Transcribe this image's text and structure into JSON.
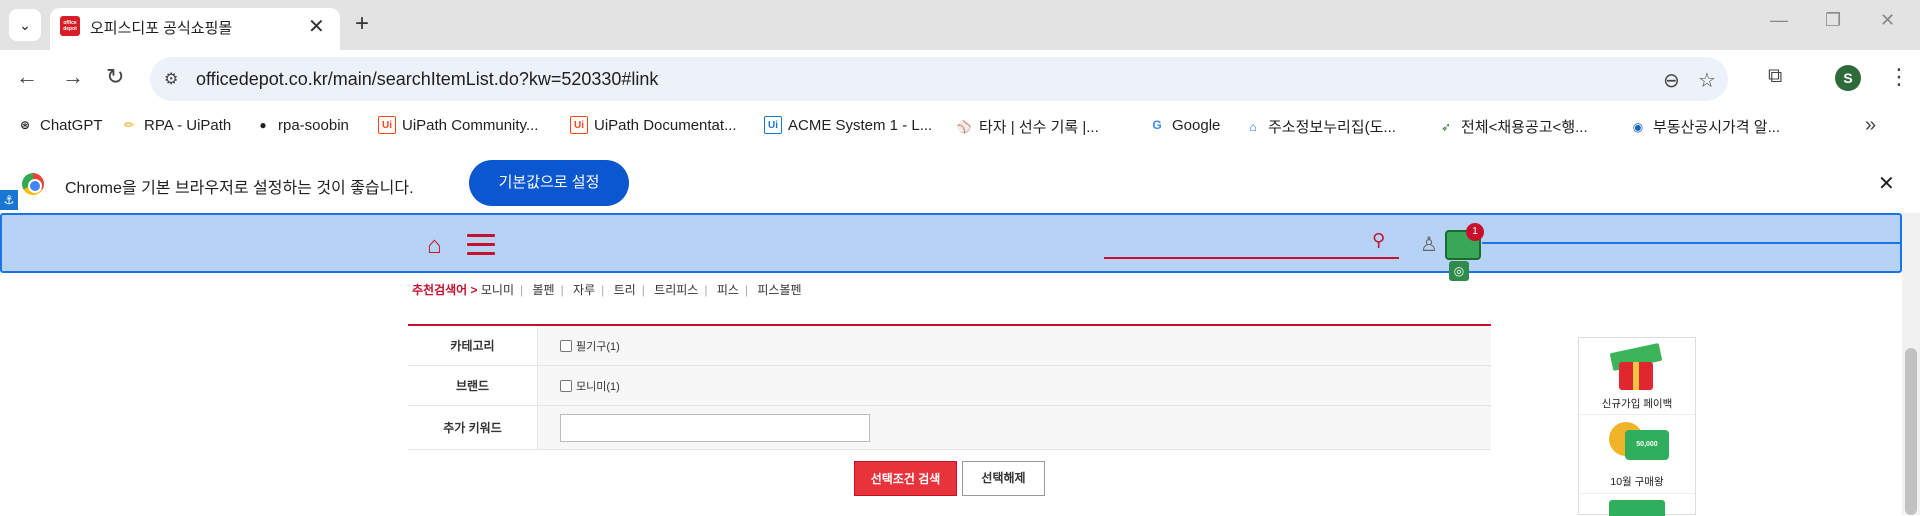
{
  "browser": {
    "tab": {
      "title": "오피스디포 공식쇼핑몰",
      "favicon_text": "office depot"
    },
    "url": "officedepot.co.kr/main/searchItemList.do?kw=520330#link",
    "profile_initial": "S",
    "bookmarks": [
      {
        "label": "ChatGPT",
        "icon": "chatgpt-icon",
        "glyph": "⊛",
        "color": "#222222"
      },
      {
        "label": "RPA - UiPath",
        "icon": "pencil-icon",
        "glyph": "✏",
        "color": "#e8a200"
      },
      {
        "label": "rpa-soobin",
        "icon": "github-icon",
        "glyph": "●",
        "color": "#111111"
      },
      {
        "label": "UiPath Community...",
        "icon": "uipath-icon",
        "glyph": "Ui",
        "color": "#fa4616"
      },
      {
        "label": "UiPath Documentat...",
        "icon": "uipath-icon",
        "glyph": "Ui",
        "color": "#fa4616"
      },
      {
        "label": "ACME System 1 - L...",
        "icon": "acme-icon",
        "glyph": "Ui",
        "color": "#1976d2"
      },
      {
        "label": "타자 | 선수 기록 |...",
        "icon": "kbo-icon",
        "glyph": "⚾",
        "color": "#0a3c8c"
      },
      {
        "label": "Google",
        "icon": "google-icon",
        "glyph": "G",
        "color": "#4285f4"
      },
      {
        "label": "주소정보누리집(도...",
        "icon": "house-icon",
        "glyph": "⌂",
        "color": "#1a73e8"
      },
      {
        "label": "전체<채용공고<행...",
        "icon": "bird-icon",
        "glyph": "➶",
        "color": "#2e7d32"
      },
      {
        "label": "부동산공시가격 알...",
        "icon": "globe-icon",
        "glyph": "◉",
        "color": "#1565c0"
      }
    ],
    "infobar": {
      "message": "Chrome을 기본 브라우저로 설정하는 것이 좋습니다.",
      "button": "기본값으로 설정"
    }
  },
  "page": {
    "header": {
      "cart_count": "1"
    },
    "recommended": {
      "label": "추천검색어 >",
      "terms": [
        "모니미",
        "볼펜",
        "자루",
        "트리",
        "트리피스",
        "피스",
        "피스볼펜"
      ]
    },
    "filters": {
      "category": {
        "label": "카테고리",
        "option": "필기구(1)"
      },
      "brand": {
        "label": "브랜드",
        "option": "모니미(1)"
      },
      "keyword": {
        "label": "추가 키워드",
        "value": ""
      }
    },
    "buttons": {
      "search": "선택조건 검색",
      "reset": "선택해제"
    },
    "side_banner": [
      {
        "label": "신규가입 페이백"
      },
      {
        "label": "10월 구매왕",
        "card_text": "50,000"
      }
    ]
  },
  "colors": {
    "brand_red": "#c8102e",
    "chrome_blue": "#0b57d0",
    "highlight": "#b6d3f5"
  }
}
